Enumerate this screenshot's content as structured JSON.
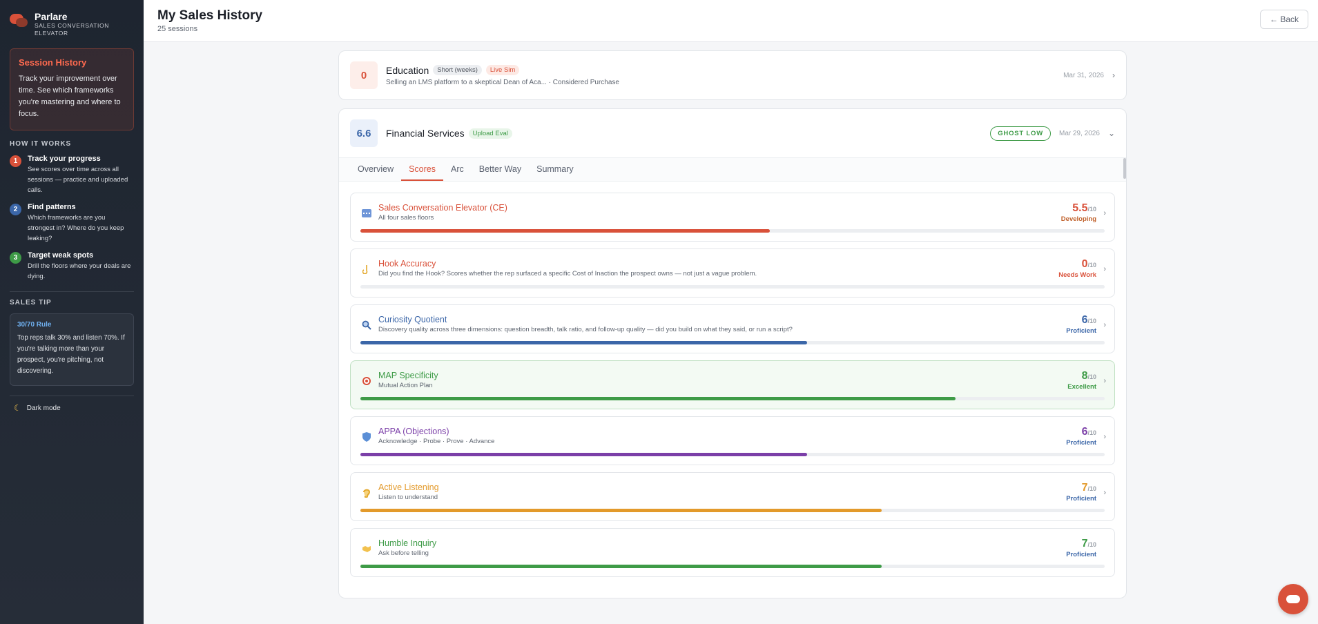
{
  "brand": {
    "name": "Parlare",
    "subtitle": "SALES CONVERSATION ELEVATOR"
  },
  "sidebar": {
    "history_title": "Session History",
    "history_text": "Track your improvement over time. See which frameworks you're mastering and where to focus.",
    "how_label": "HOW IT WORKS",
    "steps": [
      {
        "num": "1",
        "title": "Track your progress",
        "desc": "See scores over time across all sessions — practice and uploaded calls."
      },
      {
        "num": "2",
        "title": "Find patterns",
        "desc": "Which frameworks are you strongest in? Where do you keep leaking?"
      },
      {
        "num": "3",
        "title": "Target weak spots",
        "desc": "Drill the floors where your deals are dying."
      }
    ],
    "tip_label": "SALES TIP",
    "tip_title": "30/70 Rule",
    "tip_text": "Top reps talk 30% and listen 70%. If you're talking more than your prospect, you're pitching, not discovering.",
    "dark_mode": "Dark mode"
  },
  "header": {
    "title": "My Sales History",
    "subtitle": "25 sessions",
    "back": "← Back"
  },
  "sessions": [
    {
      "score": "0",
      "title": "Education",
      "badges": [
        "Short (weeks)",
        "Live Sim"
      ],
      "desc": "Selling an LMS platform to a skeptical Dean of Aca... · Considered Purchase",
      "date": "Mar 31, 2026"
    },
    {
      "score": "6.6",
      "title": "Financial Services",
      "badges": [
        "Upload Eval"
      ],
      "ghost": "GHOST LOW",
      "date": "Mar 29, 2026"
    }
  ],
  "tabs": [
    "Overview",
    "Scores",
    "Arc",
    "Better Way",
    "Summary"
  ],
  "metrics": [
    {
      "name": "Sales Conversation Elevator (CE)",
      "desc": "All four sales floors",
      "value": "5.5",
      "out_of": "/10",
      "level": "Developing",
      "fraction": 0.55,
      "color": "#d9513a",
      "level_color": "#c0612b",
      "icon": "grid-icon"
    },
    {
      "name": "Hook Accuracy",
      "desc": "Did you find the Hook? Scores whether the rep surfaced a specific Cost of Inaction the prospect owns — not just a vague problem.",
      "value": "0",
      "out_of": "/10",
      "level": "Needs Work",
      "fraction": 0,
      "color": "#d9513a",
      "level_color": "#d9513a",
      "icon": "hook-icon"
    },
    {
      "name": "Curiosity Quotient",
      "desc": "Discovery quality across three dimensions: question breadth, talk ratio, and follow-up quality — did you build on what they said, or run a script?",
      "value": "6",
      "out_of": "/10",
      "level": "Proficient",
      "fraction": 0.6,
      "color": "#3b66a8",
      "level_color": "#3b66a8",
      "icon": "magnifier-icon"
    },
    {
      "name": "MAP Specificity",
      "desc": "Mutual Action Plan",
      "value": "8",
      "out_of": "/10",
      "level": "Excellent",
      "fraction": 0.8,
      "color": "#3e9b47",
      "level_color": "#3e9b47",
      "icon": "target-icon"
    },
    {
      "name": "APPA (Objections)",
      "desc": "Acknowledge · Probe · Prove · Advance",
      "value": "6",
      "out_of": "/10",
      "level": "Proficient",
      "fraction": 0.6,
      "color": "#7b3fa8",
      "level_color": "#3b66a8",
      "icon": "shield-icon"
    },
    {
      "name": "Active Listening",
      "desc": "Listen to understand",
      "value": "7",
      "out_of": "/10",
      "level": "Proficient",
      "fraction": 0.7,
      "color": "#e39a2b",
      "level_color": "#3b66a8",
      "icon": "ear-icon"
    },
    {
      "name": "Humble Inquiry",
      "desc": "Ask before telling",
      "value": "7",
      "out_of": "/10",
      "level": "Proficient",
      "fraction": 0.7,
      "color": "#3e9b47",
      "level_color": "#3b66a8",
      "icon": "handshake-icon"
    }
  ]
}
